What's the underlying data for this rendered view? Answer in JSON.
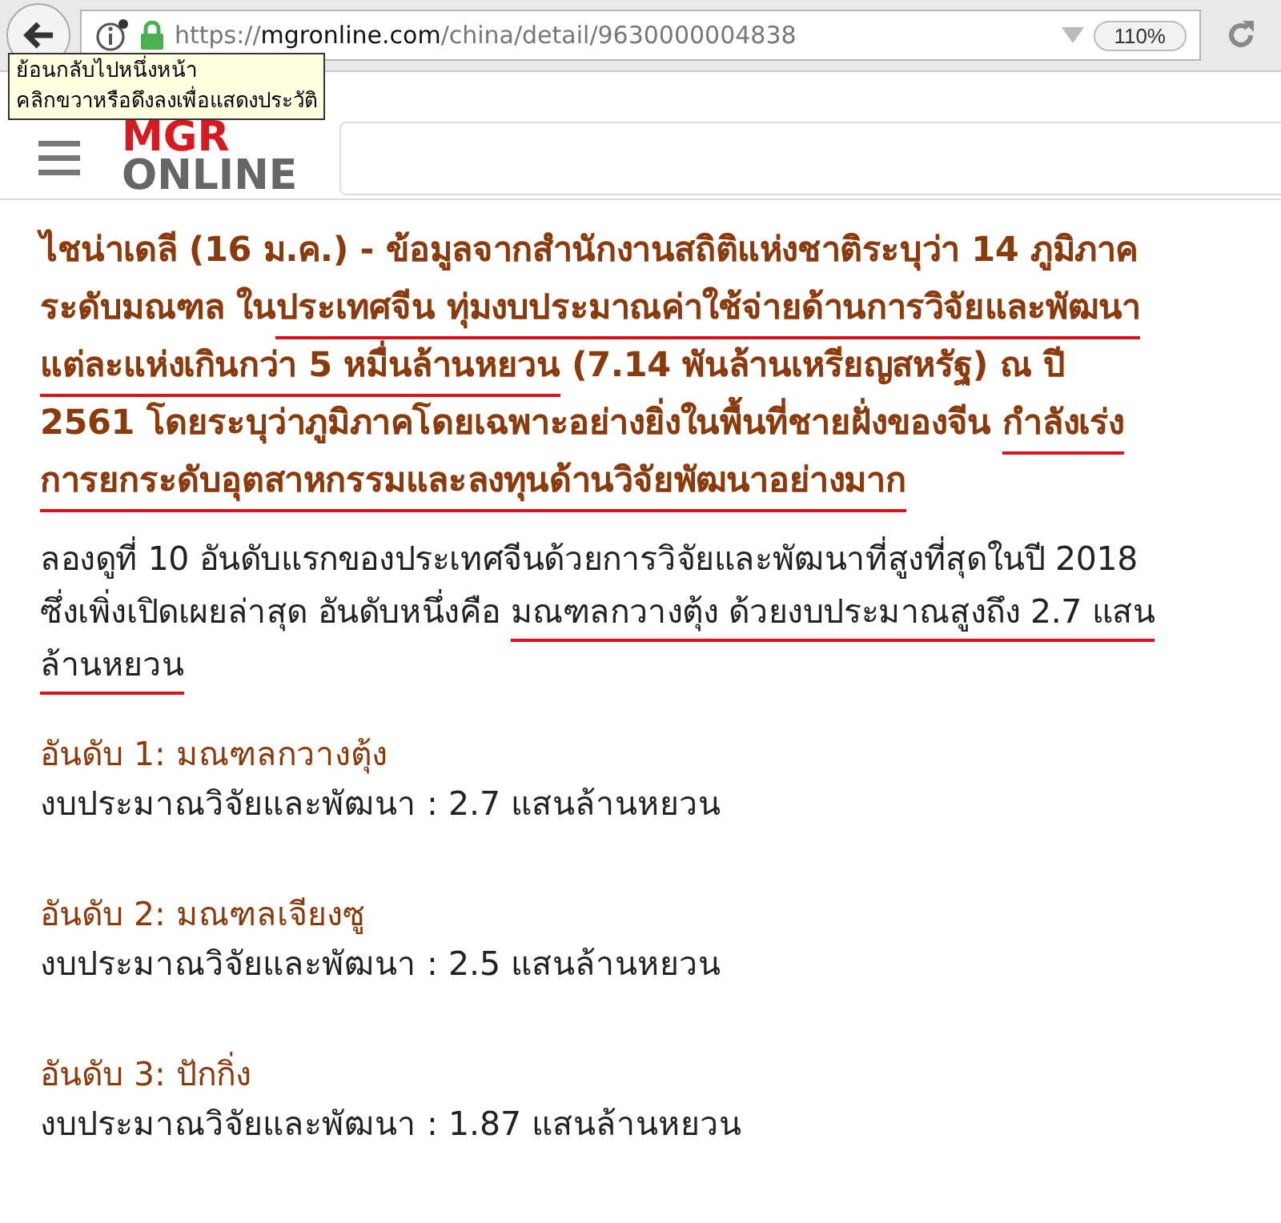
{
  "browser": {
    "url_prefix": "https://",
    "url_host": "mgronline.com",
    "url_path": "/china/detail/9630000004838",
    "zoom": "110%"
  },
  "tooltip": {
    "lines": [
      "ย้อนกลับไปหนึ่งหน้า",
      "คลิกขวาหรือดึงลงเพื่อแสดงประวัติ"
    ]
  },
  "header": {
    "logo_top": "MGR",
    "logo_bottom": "ONLINE"
  },
  "article": {
    "lead": [
      [
        {
          "text": "ไชน่าเดลี (16 ม.ค.) - ข้อมูลจากสำนักงานสถิติแห่งชาติระบุว่า 14 ภูมิภาค",
          "marked": false
        }
      ],
      [
        {
          "text": "ระดับมณฑล ใน",
          "marked": false
        },
        {
          "text": "ประเทศจีน ทุ่มงบประมาณค่าใช้จ่ายด้านการวิจัยและพัฒนา",
          "marked": true
        }
      ],
      [
        {
          "text": "แต่ละแห่งเกินกว่า 5 หมื่นล้านหยวน",
          "marked": true
        },
        {
          "text": " (7.14 พันล้านเหรียญสหรัฐ) ณ ปี",
          "marked": false
        }
      ],
      [
        {
          "text": "2561 โดยระบุว่าภูมิภาคโดยเฉพาะอย่างยิ่งในพื้นที่ชายฝั่งของจีน ",
          "marked": false
        },
        {
          "text": "กำลังเร่ง",
          "marked": true
        }
      ],
      [
        {
          "text": "การยกระดับอุตสาหกรรมและลงทุนด้านวิจัยพัฒนาอย่างมาก",
          "marked": true
        }
      ]
    ],
    "body": [
      [
        {
          "text": "ลองดูที่ 10 อันดับแรกของประเทศจีนด้วยการวิจัยและพัฒนาที่สูงที่สุดในปี 2018",
          "marked": false
        }
      ],
      [
        {
          "text": "ซึ่งเพิ่งเปิดเผยล่าสุด อันดับหนึ่งคือ ",
          "marked": false
        },
        {
          "text": "มณฑลกวางตุ้ง ด้วยงบประมาณสูงถึง 2.7 แสน",
          "marked": true
        }
      ],
      [
        {
          "text": "ล้านหยวน",
          "marked": true
        }
      ]
    ],
    "rankings": [
      {
        "title": "อันดับ 1: มณฑลกวางตุ้ง",
        "budget": "งบประมาณวิจัยและพัฒนา : 2.7 แสนล้านหยวน"
      },
      {
        "title": "อันดับ 2: มณฑลเจียงซู",
        "budget": "งบประมาณวิจัยและพัฒนา : 2.5 แสนล้านหยวน"
      },
      {
        "title": "อันดับ 3: ปักกิ่ง",
        "budget": "งบประมาณวิจัยและพัฒนา : 1.87 แสนล้านหยวน"
      }
    ]
  }
}
